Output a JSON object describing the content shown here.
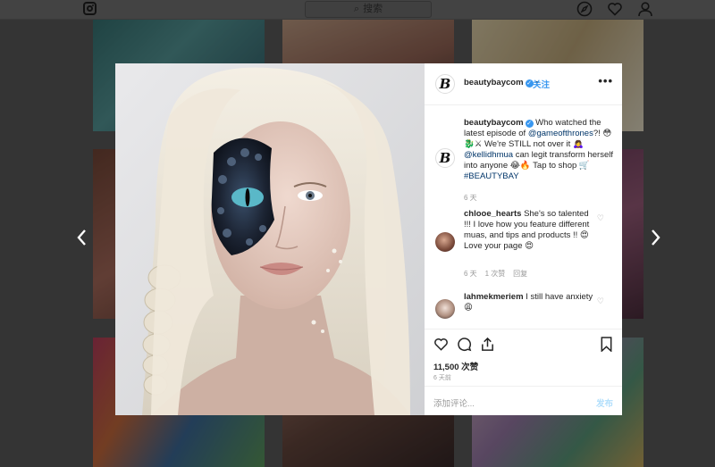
{
  "topbar": {
    "search_placeholder": "搜索",
    "icons": [
      "instagram-icon",
      "explore-icon",
      "heart-icon",
      "profile-icon"
    ]
  },
  "post": {
    "username": "beautybaycom",
    "verified": true,
    "separator": "•",
    "follow_label": "关注",
    "more_label": "•••",
    "caption": {
      "username": "beautybaycom",
      "text_1": "Who watched the latest episode of",
      "mention_1": "@gameofthrones",
      "text_2": "?! 😳🐉⚔ We're STILL not over it 🙇‍♀️",
      "mention_2": "@kellidhmua",
      "text_3": "can legit transform herself into anyone 😂🔥 Tap to shop 🛒",
      "hashtag": "#BEAUTYBAY",
      "time": "6 天"
    },
    "comments": [
      {
        "username": "chlooe_hearts",
        "text": "She's so talented !!! I love how you feature different muas, and tips and products !! 😍 Love your page 😍",
        "time": "6 天",
        "likes": "1 次赞",
        "reply": "回复"
      },
      {
        "username": "lahmekmeriem",
        "text": "I still have anxiety 😩"
      }
    ],
    "likes": "11,500 次赞",
    "date": "6 天前",
    "add_comment_placeholder": "添加评论...",
    "publish_label": "发布"
  },
  "colors": {
    "accent": "#3897f0",
    "publish_disabled": "#b2dffc"
  }
}
